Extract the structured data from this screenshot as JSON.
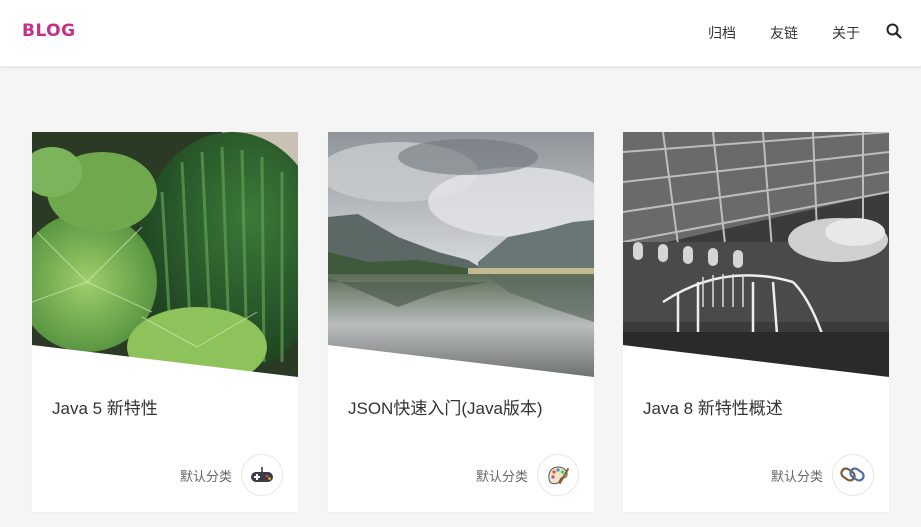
{
  "header": {
    "logo": "BLOG",
    "nav": [
      {
        "label": "归档"
      },
      {
        "label": "友链"
      },
      {
        "label": "关于"
      }
    ],
    "search_icon": "search-icon"
  },
  "colors": {
    "logo": "#c43089",
    "background": "#f5f5f5",
    "card": "#ffffff"
  },
  "posts": [
    {
      "title": "Java 5 新特性",
      "category": "默认分类",
      "image": "cactus-photo",
      "category_icon": "gamepad-icon"
    },
    {
      "title": "JSON快速入门(Java版本)",
      "category": "默认分类",
      "image": "mountain-lake-photo",
      "category_icon": "palette-icon"
    },
    {
      "title": "Java 8 新特性概述",
      "category": "默认分类",
      "image": "museum-skeleton-photo",
      "category_icon": "chain-link-icon"
    }
  ]
}
